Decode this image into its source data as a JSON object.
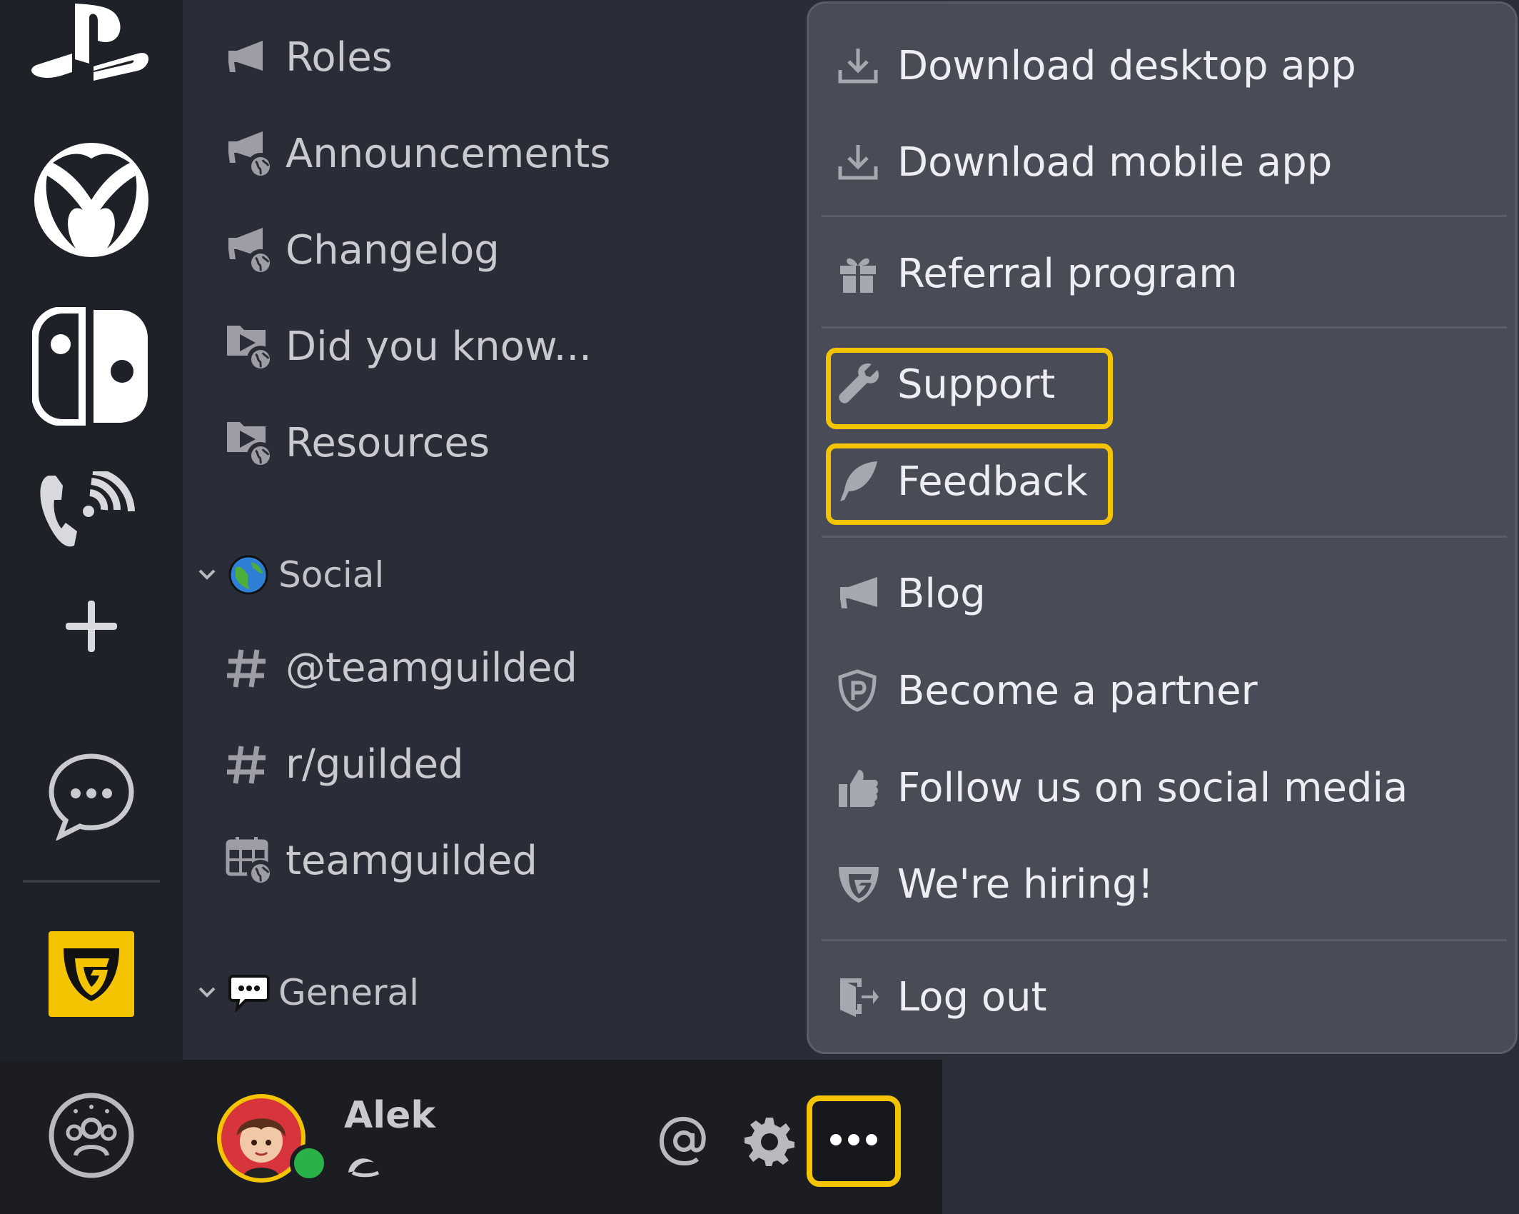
{
  "rail": {
    "servers": [
      {
        "name": "playstation",
        "icon": "playstation-icon"
      },
      {
        "name": "xbox",
        "icon": "xbox-icon"
      },
      {
        "name": "nintendo-switch",
        "icon": "switch-icon"
      },
      {
        "name": "voice",
        "icon": "phone-signal-icon"
      }
    ],
    "add_icon": "plus-icon",
    "dm_icon": "chat-bubble-icon",
    "active_server_icon": "guilded-logo-icon"
  },
  "channels": {
    "items": [
      {
        "label": "Roles",
        "icon": "megaphone-icon"
      },
      {
        "label": "Announcements",
        "icon": "megaphone-icon",
        "public": true
      },
      {
        "label": "Changelog",
        "icon": "megaphone-icon",
        "public": true
      },
      {
        "label": "Did you know...",
        "icon": "media-folder-icon",
        "public": true
      },
      {
        "label": "Resources",
        "icon": "media-folder-icon",
        "public": true
      }
    ],
    "category_social": {
      "label": "Social",
      "emoji": "globe-emoji"
    },
    "social_items": [
      {
        "label": "@teamguilded",
        "icon": "hash-icon"
      },
      {
        "label": "r/guilded",
        "icon": "hash-icon"
      },
      {
        "label": "teamguilded",
        "icon": "calendar-icon",
        "public": true
      }
    ],
    "category_general": {
      "label": "General",
      "emoji": "speech-bubble-emoji"
    }
  },
  "user": {
    "name": "Alek",
    "status_color": "#2ab24a"
  },
  "menu": {
    "items": [
      {
        "label": "Download desktop app",
        "icon": "download-icon"
      },
      {
        "label": "Download mobile app",
        "icon": "download-icon"
      },
      {
        "label": "Referral program",
        "icon": "gift-icon"
      },
      {
        "label": "Support",
        "icon": "wrench-icon",
        "highlighted": true
      },
      {
        "label": "Feedback",
        "icon": "feather-icon",
        "highlighted": true
      },
      {
        "label": "Blog",
        "icon": "megaphone-icon"
      },
      {
        "label": "Become a partner",
        "icon": "partner-shield-icon"
      },
      {
        "label": "Follow us on social media",
        "icon": "thumbs-up-icon"
      },
      {
        "label": "We're hiring!",
        "icon": "guilded-shield-icon"
      },
      {
        "label": "Log out",
        "icon": "logout-icon"
      }
    ]
  },
  "colors": {
    "accent": "#f5c400",
    "menu_bg": "#494c57",
    "rail_bg": "#1f2128",
    "channel_bg": "#2a2d37"
  }
}
